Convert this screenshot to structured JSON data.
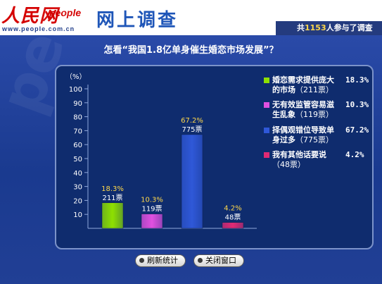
{
  "header": {
    "logo_text": "人民网",
    "logo_sub": "people",
    "logo_url": "www.people.com.cn",
    "title": "网上调查",
    "participants_prefix": "共",
    "participants_count": "1153",
    "participants_suffix": "人参与了调查"
  },
  "watermark": "people",
  "question": "怎看“我国1.8亿单身催生婚恋市场发展”？",
  "buttons": {
    "refresh": "刷新统计",
    "close": "关闭窗口"
  },
  "colors": {
    "bar1": "#8ee000",
    "bar2": "#e050e0",
    "bar3": "#2f58d8",
    "bar4": "#e02a74"
  },
  "chart_data": {
    "type": "bar",
    "title": "怎看“我国1.8亿单身催生婚恋市场发展”？",
    "ylabel": "（%）",
    "ylim": [
      0,
      100
    ],
    "yticks": [
      "10",
      "20",
      "30",
      "40",
      "50",
      "60",
      "70",
      "80",
      "90",
      "100"
    ],
    "grid": false,
    "legend_position": "right",
    "series": [
      {
        "name": "婚恋需求提供庞大的市场",
        "percent_label": "18.3%",
        "count_label": "211票",
        "legend_count": "（211票）",
        "value": 18.3,
        "votes": 211
      },
      {
        "name": "无有效监管容易滋生乱象",
        "percent_label": "10.3%",
        "count_label": "119票",
        "legend_count": "（119票）",
        "value": 10.3,
        "votes": 119
      },
      {
        "name": "择偶观错位导致单身过多",
        "percent_label": "67.2%",
        "count_label": "775票",
        "legend_count": "（775票）",
        "value": 67.2,
        "votes": 775
      },
      {
        "name": "我有其他话要说",
        "percent_label": "4.2%",
        "count_label": "48票",
        "legend_count": "（48票）",
        "value": 4.2,
        "votes": 48
      }
    ]
  }
}
